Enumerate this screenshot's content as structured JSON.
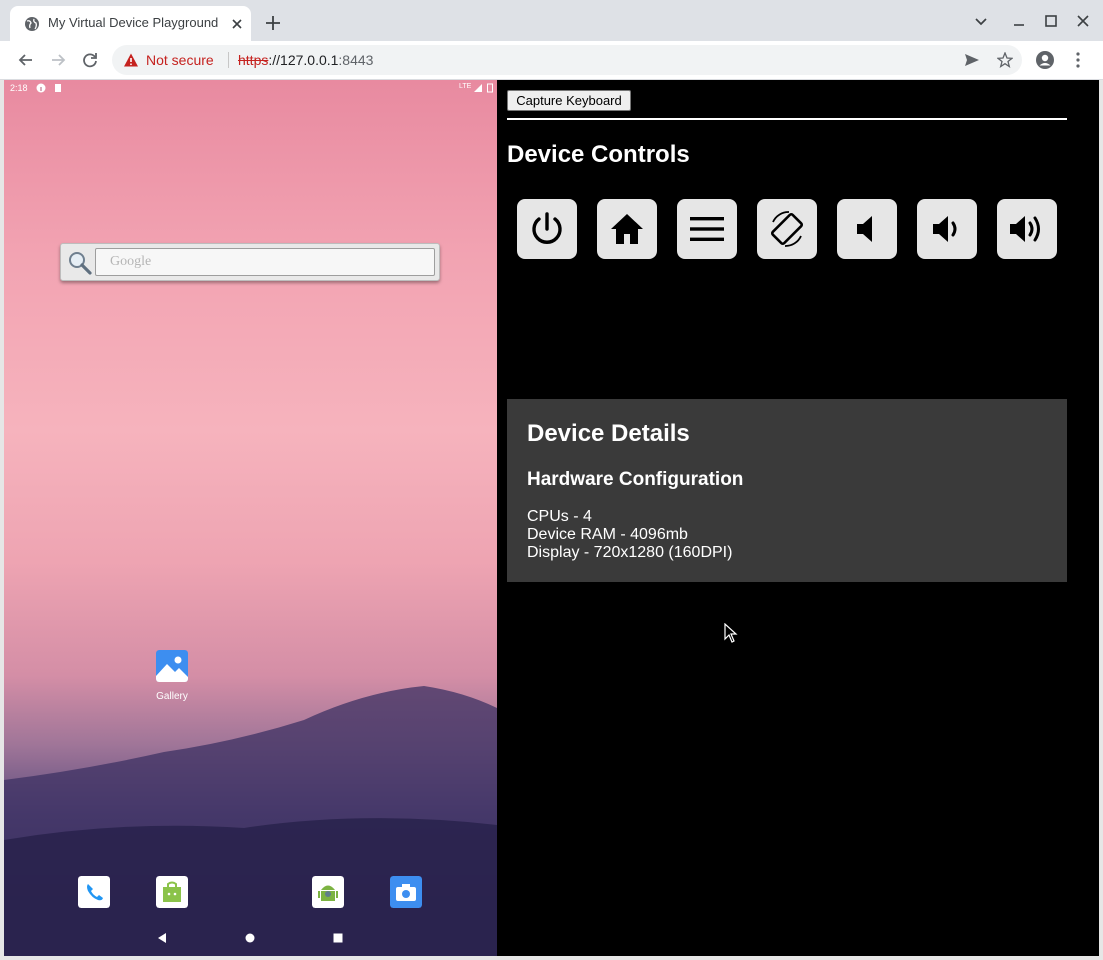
{
  "browser": {
    "tab_title": "My Virtual Device Playground",
    "security_label": "Not secure",
    "url_scheme": "https",
    "url_sep": "://",
    "url_host": "127.0.0.1",
    "url_port": ":8443"
  },
  "android": {
    "status_time": "2:18",
    "status_network": "LTE",
    "search_placeholder": "Google",
    "home_apps": [
      {
        "label": "Gallery",
        "icon": "gallery-icon"
      }
    ],
    "dock_apps": [
      "phone-icon",
      "store-icon",
      "android-icon",
      "camera-icon"
    ],
    "nav_keys": [
      "back-icon",
      "home-circle-icon",
      "recents-icon"
    ]
  },
  "controls": {
    "capture_keyboard_label": "Capture Keyboard",
    "title": "Device Controls",
    "buttons": [
      "power-icon",
      "home-icon",
      "menu-icon",
      "rotate-icon",
      "volume-mute-icon",
      "volume-down-icon",
      "volume-up-icon"
    ]
  },
  "details": {
    "title": "Device Details",
    "hardware_title": "Hardware Configuration",
    "cpus": "CPUs - 4",
    "ram": "Device RAM - 4096mb",
    "display": "Display - 720x1280 (160DPI)"
  },
  "colors": {
    "page_bg": "#000000",
    "details_bg": "#3a3a3a",
    "button_bg": "#e6e6e6",
    "warning_red": "#c5221f"
  }
}
